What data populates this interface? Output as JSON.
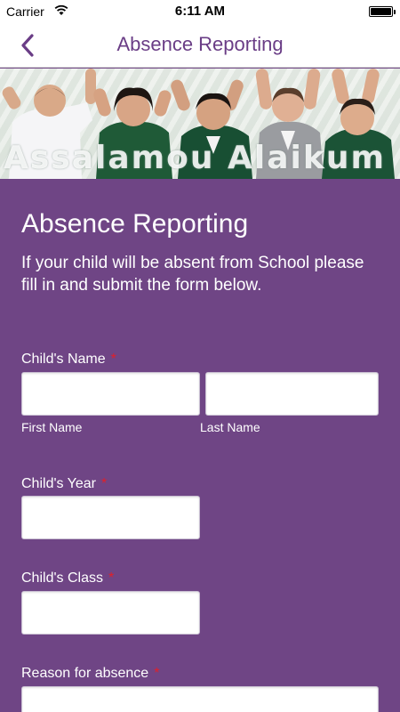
{
  "status_bar": {
    "carrier": "Carrier",
    "time": "6:11 AM"
  },
  "nav": {
    "title": "Absence Reporting"
  },
  "banner": {
    "caption": "Assalamou Alaikum"
  },
  "form": {
    "heading": "Absence Reporting",
    "intro": "If your child will be absent from School please fill in and submit the form below.",
    "required_mark": "*",
    "fields": {
      "childs_name": {
        "label": "Child's Name",
        "first_label": "First Name",
        "last_label": "Last Name",
        "first_value": "",
        "last_value": ""
      },
      "childs_year": {
        "label": "Child's Year",
        "value": ""
      },
      "childs_class": {
        "label": "Child's Class",
        "value": ""
      },
      "reason": {
        "label": "Reason for absence",
        "value": ""
      }
    }
  },
  "colors": {
    "accent": "#6a3d86",
    "background": "#6f4585",
    "required": "#e0202a"
  }
}
